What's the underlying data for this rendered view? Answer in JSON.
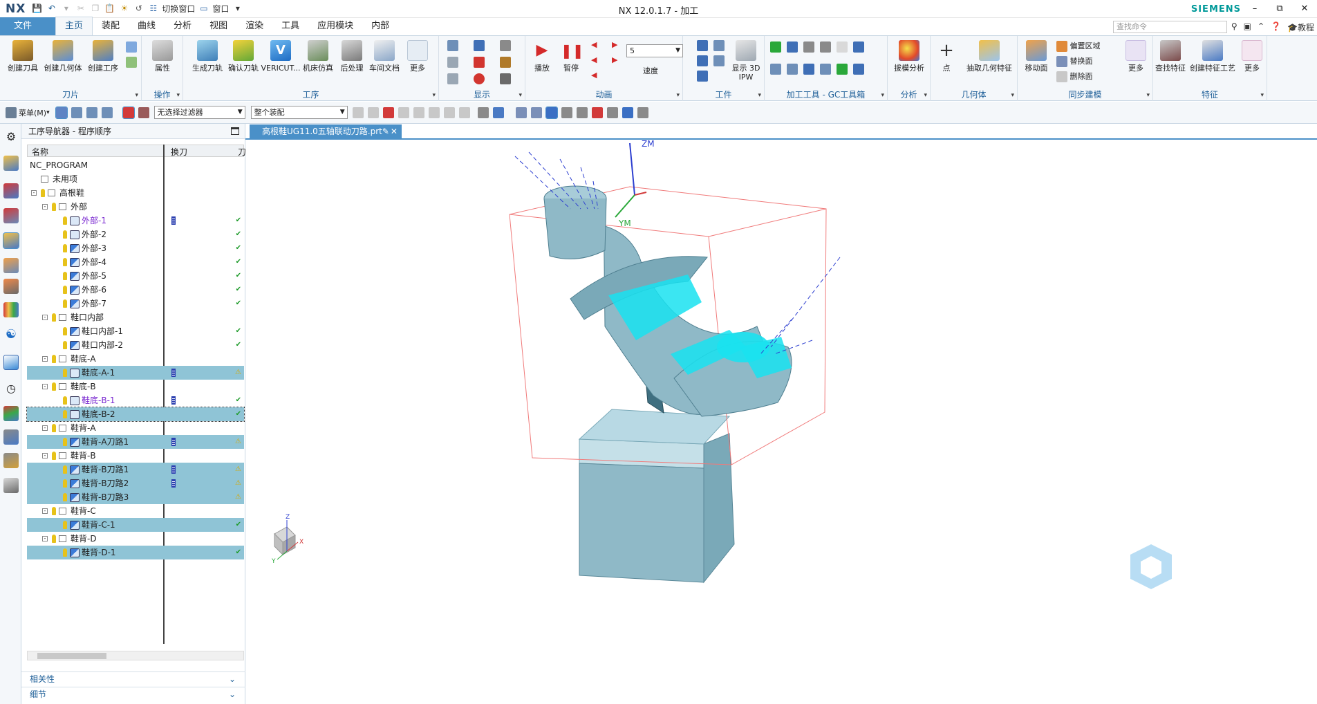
{
  "app": {
    "logo": "NX",
    "window_title": "NX 12.0.1.7 - 加工",
    "brand": "SIEMENS",
    "quick_access": {
      "switch_window": "切换窗口",
      "window": "窗口"
    },
    "command_search_placeholder": "查找命令",
    "right_help_text": "教程"
  },
  "menu_tabs": [
    "文件(F)",
    "主页",
    "装配",
    "曲线",
    "分析",
    "视图",
    "渲染",
    "工具",
    "应用模块",
    "内部"
  ],
  "active_tab_index": 1,
  "ribbon": {
    "groups": [
      {
        "label": "刀片",
        "buttons": [
          "创建刀具",
          "创建几何体",
          "创建工序"
        ]
      },
      {
        "label": "操作",
        "buttons": [
          "属性"
        ]
      },
      {
        "label": "工序",
        "buttons": [
          "生成刀轨",
          "确认刀轨",
          "VERICUT...",
          "机床仿真",
          "后处理",
          "车间文档",
          "更多"
        ]
      },
      {
        "label": "显示",
        "buttons": []
      },
      {
        "label": "动画",
        "buttons": [
          "播放",
          "暂停",
          "速度"
        ],
        "speed_value": "5"
      },
      {
        "label": "工件",
        "buttons": [
          "显示 3D IPW"
        ]
      },
      {
        "label": "加工工具 - GC工具箱",
        "buttons": []
      },
      {
        "label": "分析",
        "buttons": [
          "拔模分析"
        ]
      },
      {
        "label": "几何体",
        "buttons": [
          "点",
          "抽取几何特征"
        ]
      },
      {
        "label": "同步建模",
        "buttons": [
          "移动面",
          "偏置区域",
          "替换面",
          "删除面",
          "更多"
        ]
      },
      {
        "label": "特征",
        "buttons": [
          "查找特征",
          "创建特征工艺",
          "更多"
        ]
      }
    ]
  },
  "toolbar2": {
    "menu_label": "菜单(M)",
    "filter": "无选择过滤器",
    "assembly_scope": "整个装配"
  },
  "navigator": {
    "title": "工序导航器 - 程序顺序",
    "columns": [
      "名称",
      "换刀",
      "刀"
    ],
    "rows": [
      {
        "name": "NC_PROGRAM",
        "level": 0,
        "kind": "root"
      },
      {
        "name": "未用项",
        "level": 1,
        "kind": "folder"
      },
      {
        "name": "高根鞋",
        "level": 1,
        "kind": "program",
        "expand": "-"
      },
      {
        "name": "外部",
        "level": 2,
        "kind": "program",
        "expand": "-"
      },
      {
        "name": "外部-1",
        "level": 3,
        "kind": "op-a",
        "purple": true,
        "tool_change": true,
        "status": "check"
      },
      {
        "name": "外部-2",
        "level": 3,
        "kind": "op-a",
        "status": "check"
      },
      {
        "name": "外部-3",
        "level": 3,
        "kind": "op-c",
        "status": "check"
      },
      {
        "name": "外部-4",
        "level": 3,
        "kind": "op-c",
        "status": "check"
      },
      {
        "name": "外部-5",
        "level": 3,
        "kind": "op-c",
        "status": "check"
      },
      {
        "name": "外部-6",
        "level": 3,
        "kind": "op-c",
        "status": "check"
      },
      {
        "name": "外部-7",
        "level": 3,
        "kind": "op-c",
        "status": "check"
      },
      {
        "name": "鞋口内部",
        "level": 2,
        "kind": "program",
        "expand": "-"
      },
      {
        "name": "鞋口内部-1",
        "level": 3,
        "kind": "op-c",
        "status": "check"
      },
      {
        "name": "鞋口内部-2",
        "level": 3,
        "kind": "op-c",
        "status": "check"
      },
      {
        "name": "鞋底-A",
        "level": 2,
        "kind": "program",
        "expand": "-"
      },
      {
        "name": "鞋底-A-1",
        "level": 3,
        "kind": "op-a",
        "highlight": true,
        "tool_change": true,
        "status": "warn"
      },
      {
        "name": "鞋底-B",
        "level": 2,
        "kind": "program",
        "expand": "-"
      },
      {
        "name": "鞋底-B-1",
        "level": 3,
        "kind": "op-a",
        "purple": true,
        "tool_change": true,
        "status": "check"
      },
      {
        "name": "鞋底-B-2",
        "level": 3,
        "kind": "op-a",
        "selected": true,
        "status": "check"
      },
      {
        "name": "鞋背-A",
        "level": 2,
        "kind": "program",
        "expand": "-"
      },
      {
        "name": "鞋背-A刀路1",
        "level": 3,
        "kind": "op-c",
        "highlight": true,
        "tool_change": true,
        "status": "warn"
      },
      {
        "name": "鞋背-B",
        "level": 2,
        "kind": "program",
        "expand": "-"
      },
      {
        "name": "鞋背-B刀路1",
        "level": 3,
        "kind": "op-c",
        "highlight": true,
        "tool_change": true,
        "status": "warn"
      },
      {
        "name": "鞋背-B刀路2",
        "level": 3,
        "kind": "op-c",
        "highlight": true,
        "tool_change": true,
        "status": "warn"
      },
      {
        "name": "鞋背-B刀路3",
        "level": 3,
        "kind": "op-c",
        "highlight": true,
        "status": "warn"
      },
      {
        "name": "鞋背-C",
        "level": 2,
        "kind": "program",
        "expand": "-"
      },
      {
        "name": "鞋背-C-1",
        "level": 3,
        "kind": "op-c",
        "highlight": true,
        "status": "check"
      },
      {
        "name": "鞋背-D",
        "level": 2,
        "kind": "program",
        "expand": "-"
      },
      {
        "name": "鞋背-D-1",
        "level": 3,
        "kind": "op-c",
        "highlight": true,
        "status": "check"
      }
    ],
    "sections": [
      "相关性",
      "细节"
    ]
  },
  "viewport": {
    "tab_title": "高根鞋UG11.0五轴联动刀路.prt",
    "axis_labels": {
      "zm": "ZM",
      "ym": "YM",
      "triad_x": "X",
      "triad_y": "Y",
      "triad_z": "Z"
    }
  },
  "colors": {
    "accent": "#4a90c8",
    "highlight_row": "#8fc4d6",
    "part_body": "#8fb9c7",
    "toolpath": "#19e2f0"
  }
}
